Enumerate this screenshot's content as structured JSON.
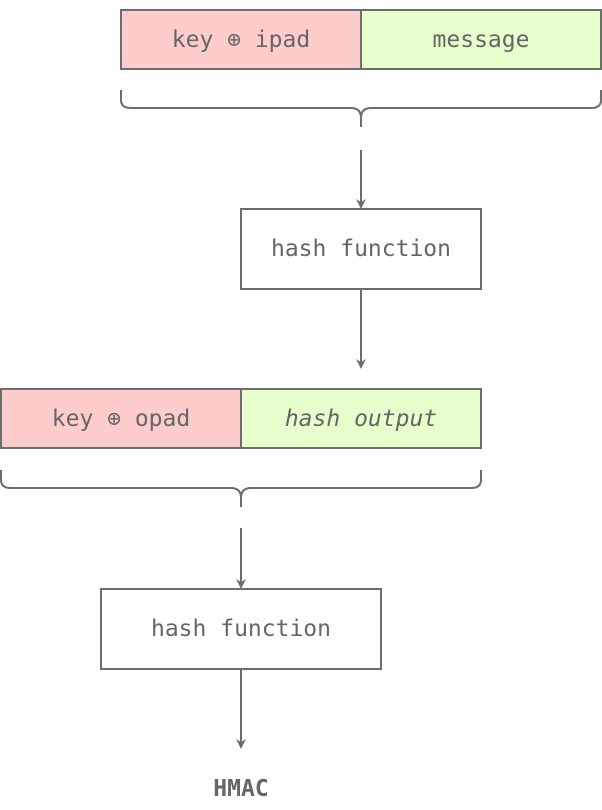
{
  "colors": {
    "key_block": "#ffcccc",
    "data_block": "#e6ffcc",
    "stroke": "#6d6d6d",
    "text": "#666666"
  },
  "stage1": {
    "key_label": "key ⊕ ipad",
    "data_label": "message",
    "hash_label": "hash function"
  },
  "stage2": {
    "key_label": "key ⊕ opad",
    "data_label": "hash output",
    "hash_label": "hash function"
  },
  "output": {
    "label": "HMAC"
  }
}
